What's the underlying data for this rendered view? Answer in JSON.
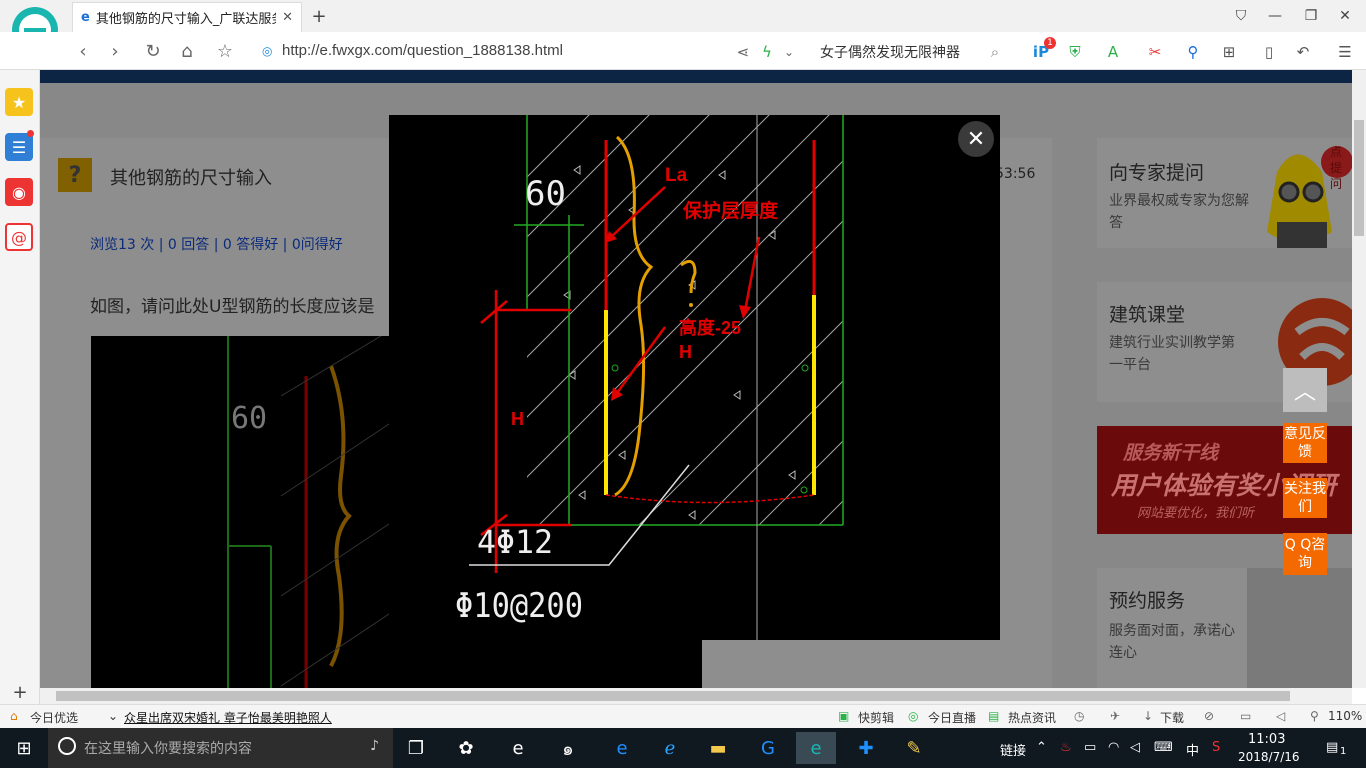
{
  "tab": {
    "title": "其他钢筋的尺寸输入_广联达服务"
  },
  "address": {
    "url": "http://e.fwxgx.com/question_1888138.html",
    "search_text": "女子偶然发现无限神器",
    "badge_count": "1"
  },
  "question": {
    "icon": "?",
    "title": "其他钢筋的尺寸输入",
    "time": "53:56",
    "stats": "浏览13 次 | 0 回答 | 0 答得好 | 0问得好",
    "body": "如图，请问此处U型钢筋的长度应该是"
  },
  "sidebar_right": {
    "expert": {
      "title": "向专家提问",
      "sub": "业界最权威专家为您解答",
      "badge": "点提问"
    },
    "class": {
      "title": "建筑课堂",
      "sub": "建筑行业实训教学第一平台"
    },
    "banner": {
      "line1": "服务新干线",
      "line2": "用户体验有奖小调研",
      "line3": "网站要优化，我们听"
    },
    "service": {
      "title": "预约服务",
      "sub": "服务面对面，承诺心连心"
    }
  },
  "float_buttons": [
    "意见反馈",
    "关注我们",
    "Q Q咨询"
  ],
  "drawing": {
    "dim60": "60",
    "label_la": "La",
    "label_cover": "保护层厚度",
    "label_height": "高度-25",
    "label_h1": "H",
    "label_h2": "H",
    "rebar": "4Φ12",
    "stirrup": "Φ10@200"
  },
  "statusbar": {
    "today": "今日优选",
    "news": "众星出席双宋婚礼 章子怡最美明艳照人",
    "clip": "快剪辑",
    "live": "今日直播",
    "hot": "热点资讯",
    "download": "下载",
    "zoom": "110%"
  },
  "taskbar": {
    "search_placeholder": "在这里输入你要搜索的内容",
    "link": "链接",
    "ime": "中",
    "time": "11:03",
    "date": "2018/7/16",
    "notif": "1"
  },
  "colors": {
    "red": "#e00000",
    "yellow": "#ffe600",
    "orange": "#e5a000",
    "green": "#22aa22",
    "accent_orange": "#f56a00"
  }
}
